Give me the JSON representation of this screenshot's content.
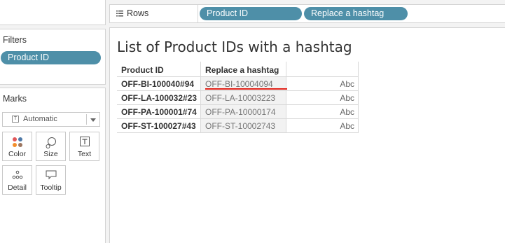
{
  "shelves": {
    "rows_label": "Rows",
    "rows_pills": [
      "Product ID",
      "Replace a hashtag"
    ]
  },
  "filters": {
    "title": "Filters",
    "pills": [
      "Product ID"
    ]
  },
  "marks": {
    "title": "Marks",
    "mark_type": "Automatic",
    "cards": [
      {
        "label": "Color",
        "icon": "color-dots-icon"
      },
      {
        "label": "Size",
        "icon": "size-shapes-icon"
      },
      {
        "label": "Text",
        "icon": "text-t-icon"
      },
      {
        "label": "Detail",
        "icon": "detail-dots-icon"
      },
      {
        "label": "Tooltip",
        "icon": "tooltip-bubble-icon"
      }
    ]
  },
  "sheet": {
    "title": "List of Product IDs with a hashtag",
    "columns": [
      "Product ID",
      "Replace a hashtag"
    ],
    "rows": [
      {
        "product_id": "OFF-BI-100040#94",
        "replaced": "OFF-BI-10004094",
        "mark": "Abc"
      },
      {
        "product_id": "OFF-LA-100032#23",
        "replaced": "OFF-LA-10003223",
        "mark": "Abc"
      },
      {
        "product_id": "OFF-PA-100001#74",
        "replaced": "OFF-PA-10000174",
        "mark": "Abc"
      },
      {
        "product_id": "OFF-ST-100027#43",
        "replaced": "OFF-ST-10002743",
        "mark": "Abc"
      }
    ]
  },
  "colors": {
    "pill": "#4e8fa8",
    "highlight_underline": "#e2231a"
  }
}
